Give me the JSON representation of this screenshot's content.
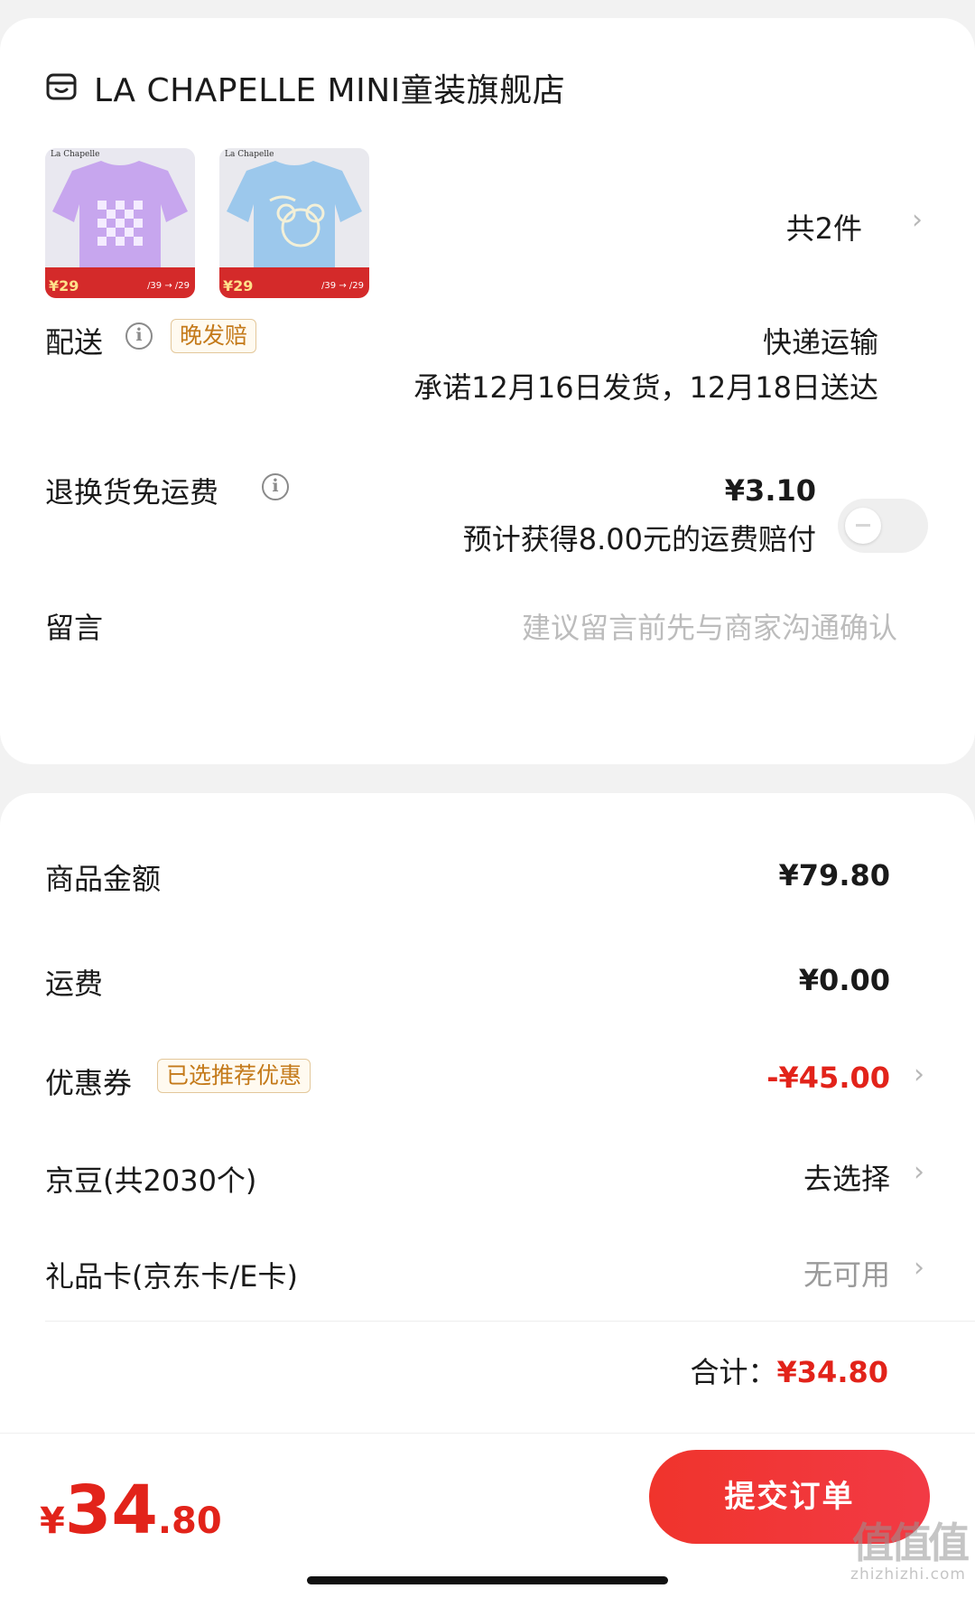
{
  "store": {
    "name": "LA CHAPELLE MINI童装旗舰店",
    "icon": "store-icon"
  },
  "products": {
    "items": [
      {
        "brand": "La Chapelle",
        "price_badge": "¥29",
        "color": "lavender",
        "promo": "/39 → /29"
      },
      {
        "brand": "La Chapelle",
        "price_badge": "¥29",
        "color": "light-blue",
        "promo": "/39 → /29"
      }
    ],
    "count_label": "共2件"
  },
  "delivery": {
    "label": "配送",
    "tag": "晚发赔",
    "method": "快递运输",
    "promise": "承诺12月16日发货，12月18日送达"
  },
  "return_shipping": {
    "label": "退换货免运费",
    "price": "¥3.10",
    "note": "预计获得8.00元的运费赔付",
    "toggle_on": false
  },
  "message": {
    "label": "留言",
    "placeholder": "建议留言前先与商家沟通确认"
  },
  "summary": {
    "goods_amount_label": "商品金额",
    "goods_amount": "¥79.80",
    "shipping_label": "运费",
    "shipping": "¥0.00",
    "coupon_label": "优惠券",
    "coupon_tag": "已选推荐优惠",
    "coupon_value": "-¥45.00",
    "jingdou_label": "京豆(共2030个)",
    "jingdou_action": "去选择",
    "giftcard_label": "礼品卡(京东卡/E卡)",
    "giftcard_value": "无可用",
    "total_label": "合计：",
    "total_value": "¥34.80"
  },
  "bottom_bar": {
    "currency": "¥",
    "price_int": "34",
    "price_dec": ".80",
    "submit_label": "提交订单"
  },
  "watermark": {
    "main": "值值值",
    "sub": "zhizhizhi.com"
  },
  "colors": {
    "accent_red": "#e2231a",
    "tag_text": "#c47a1a",
    "tag_border": "#e3c79a",
    "placeholder": "#bcbcbc"
  }
}
